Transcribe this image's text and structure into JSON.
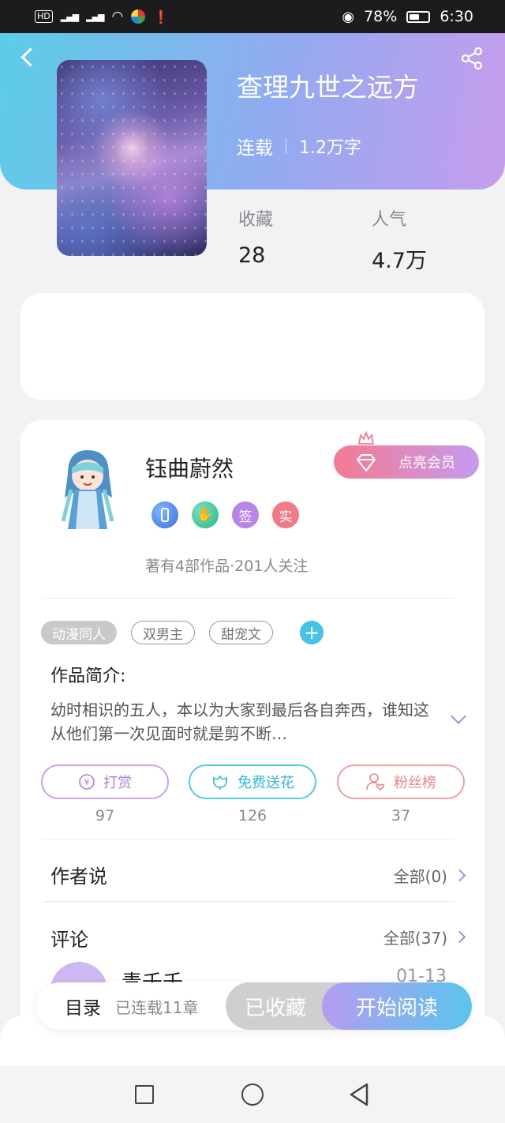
{
  "status_bar": {
    "network_chip": "HD",
    "signal1": "4G",
    "battery_percent": "78%",
    "time": "6:30"
  },
  "book": {
    "title": "查理九世之远方",
    "status": "连载",
    "word_count": "1.2万字",
    "favorites_label": "收藏",
    "favorites_value": "28",
    "popularity_label": "人气",
    "popularity_value": "4.7万"
  },
  "author": {
    "name": "钰曲蔚然",
    "badges": [
      "签",
      "实"
    ],
    "stats": "著有4部作品·201人关注",
    "vip_label": "点亮会员"
  },
  "tags": [
    "动漫同人",
    "双男主",
    "甜宠文"
  ],
  "intro": {
    "label": "作品简介:",
    "text": "幼时相识的五人，本以为大家到最后各自奔西，谁知这从他们第一次见面时就是剪不断…"
  },
  "actions": [
    {
      "label": "打赏",
      "count": "97"
    },
    {
      "label": "免费送花",
      "count": "126"
    },
    {
      "label": "粉丝榜",
      "count": "37"
    }
  ],
  "author_says": {
    "title": "作者说",
    "link": "全部(0)"
  },
  "comments": {
    "title": "评论",
    "link": "全部(37)",
    "first_user": "青千千",
    "first_date": "01-13"
  },
  "bottom_bar": {
    "toc_label": "目录",
    "chapter_count": "已连载11章",
    "favorited_label": "已收藏",
    "read_label": "开始阅读"
  },
  "colors": {
    "header_start": "#5ccde8",
    "header_end": "#c69ded",
    "accent_purple": "#b08ae0",
    "accent_cyan": "#46c2e8"
  }
}
